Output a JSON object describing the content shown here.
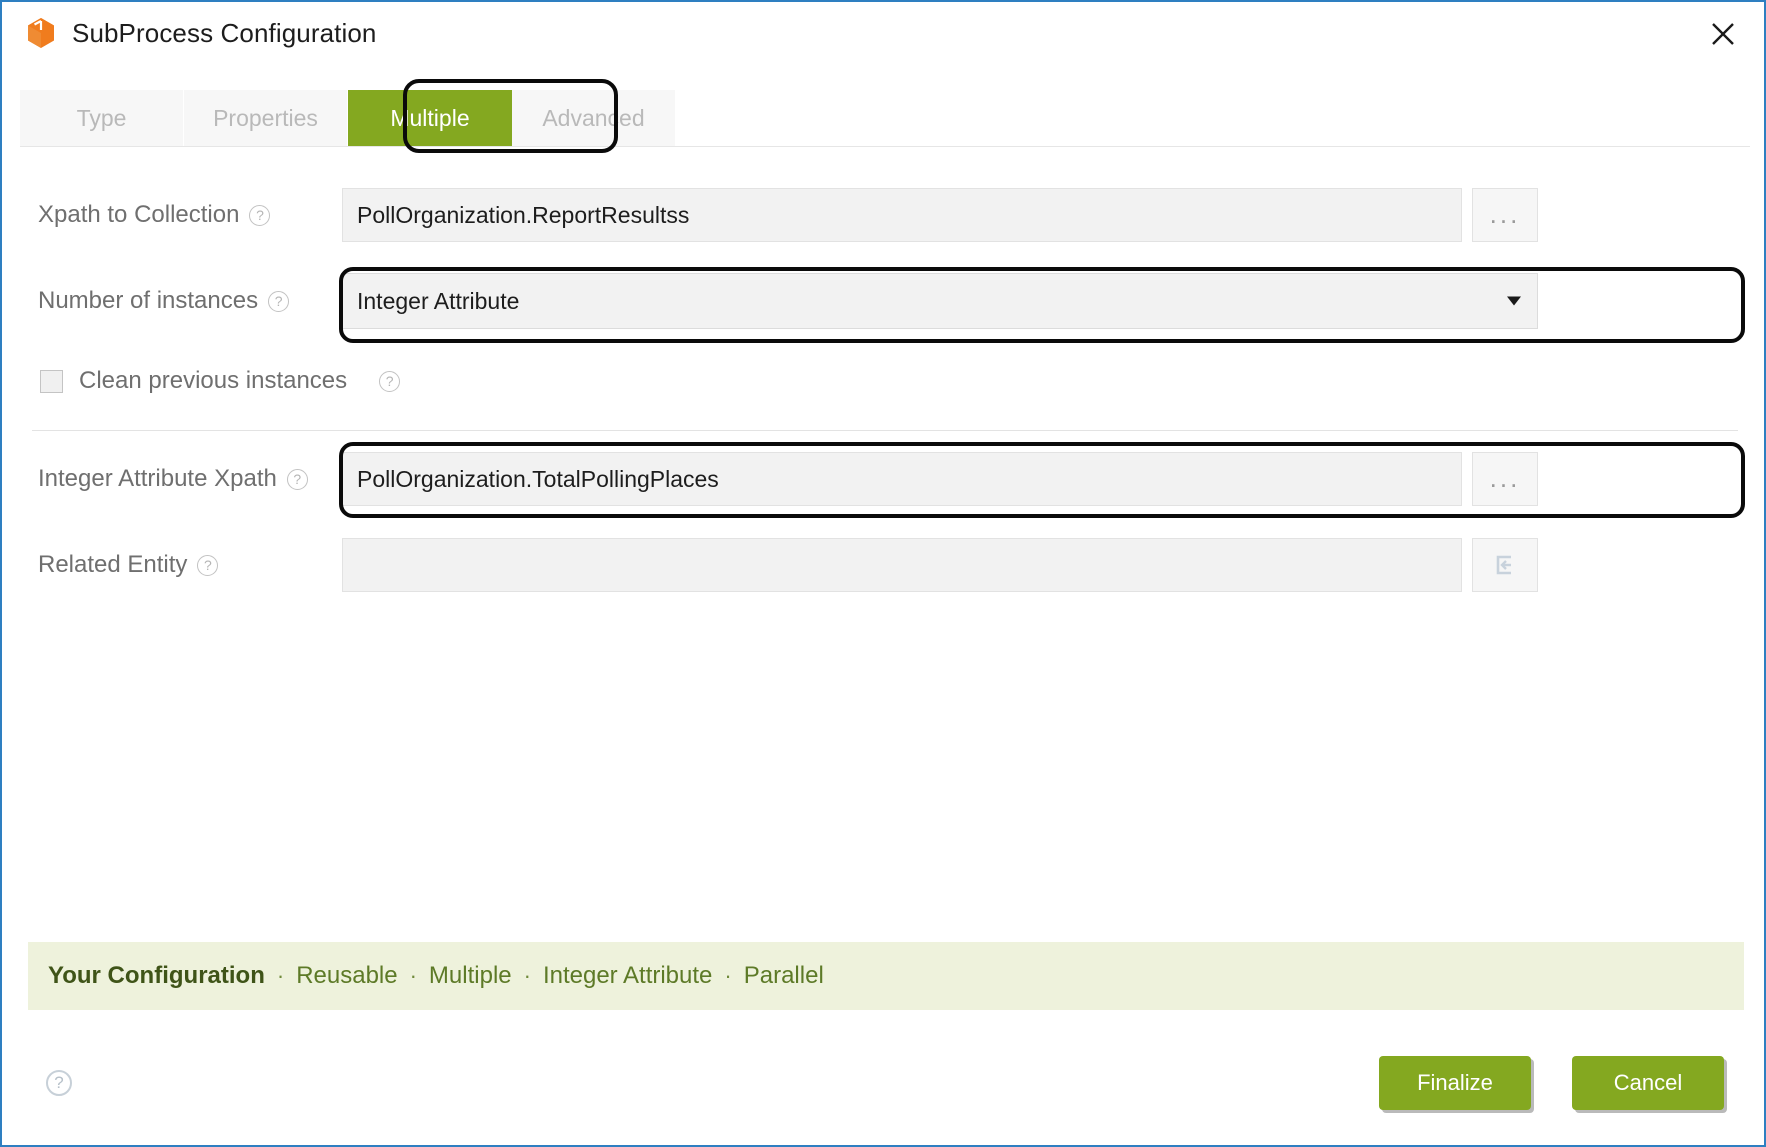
{
  "window": {
    "title": "SubProcess Configuration",
    "app_icon": "hexagon-box-icon",
    "close_icon": "close-icon"
  },
  "tabs": [
    {
      "label": "Type",
      "active": false
    },
    {
      "label": "Properties",
      "active": false
    },
    {
      "label": "Multiple",
      "active": true
    },
    {
      "label": "Advanced",
      "active": false
    }
  ],
  "form": {
    "xpath_collection": {
      "label": "Xpath to Collection",
      "value": "PollOrganization.ReportResultss",
      "browse_label": "...",
      "help_icon": "question-circle-icon"
    },
    "number_of_instances": {
      "label": "Number of instances",
      "value": "Integer Attribute",
      "options": [
        "Integer Attribute"
      ],
      "caret_icon": "chevron-down-icon",
      "help_icon": "question-circle-icon"
    },
    "clean_previous": {
      "label": "Clean previous instances",
      "checked": false,
      "help_icon": "question-circle-icon"
    },
    "integer_attribute_xpath": {
      "label": "Integer Attribute Xpath",
      "value": "PollOrganization.TotalPollingPlaces",
      "browse_label": "...",
      "help_icon": "question-circle-icon"
    },
    "related_entity": {
      "label": "Related Entity",
      "value": "",
      "select_icon": "select-entity-icon",
      "help_icon": "question-circle-icon"
    }
  },
  "summary": {
    "title": "Your Configuration",
    "separator": "·",
    "items": [
      "Reusable",
      "Multiple",
      "Integer Attribute",
      "Parallel"
    ]
  },
  "footer": {
    "help_icon": "question-circle-icon",
    "finalize_label": "Finalize",
    "cancel_label": "Cancel"
  },
  "colors": {
    "accent_green": "#84a820",
    "summary_bg": "#eef2dc",
    "summary_title": "#3f5418",
    "window_border": "#2e7fc1",
    "app_icon_orange": "#f07c1e",
    "annotation": "#0a0a0a"
  }
}
